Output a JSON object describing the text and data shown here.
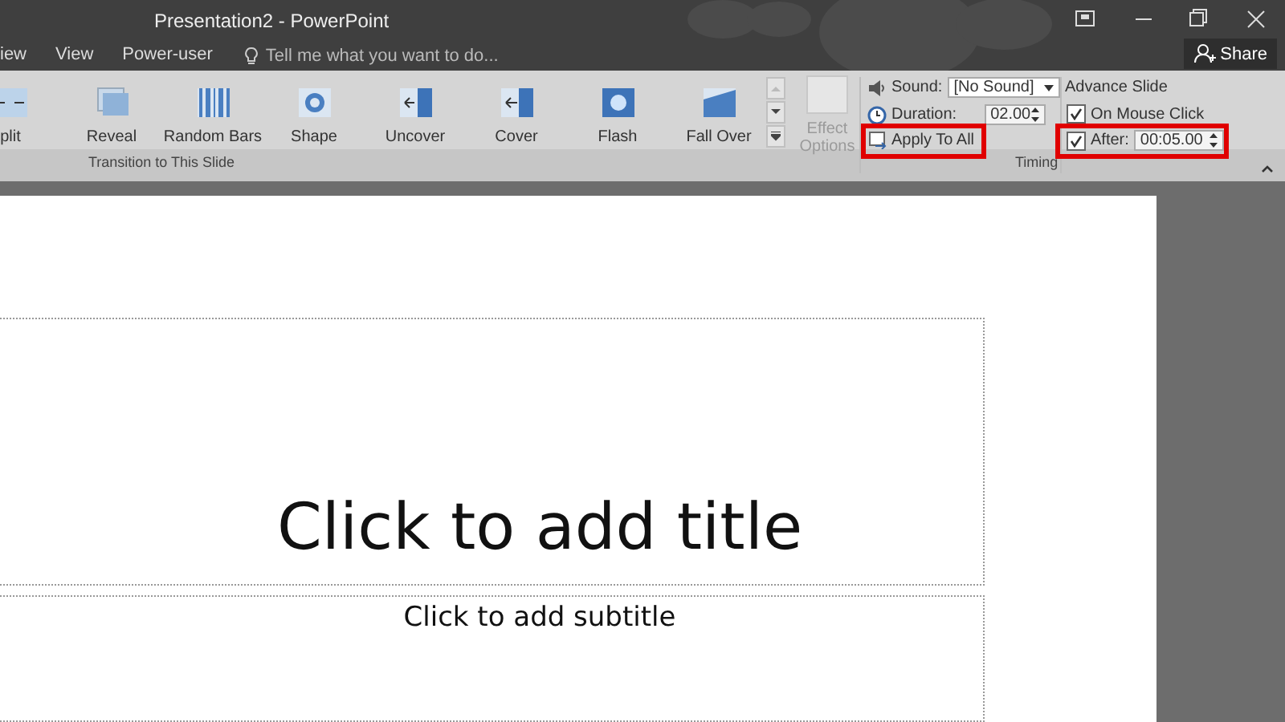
{
  "window": {
    "title": "Presentation2 - PowerPoint"
  },
  "tabs": [
    {
      "label": "iew"
    },
    {
      "label": "View"
    },
    {
      "label": "Power-user"
    }
  ],
  "tell_me": {
    "placeholder": "Tell me what you want to do..."
  },
  "share": {
    "label": "Share"
  },
  "transitions": {
    "items": [
      {
        "label": "plit"
      },
      {
        "label": "Reveal"
      },
      {
        "label": "Random Bars"
      },
      {
        "label": "Shape"
      },
      {
        "label": "Uncover"
      },
      {
        "label": "Cover"
      },
      {
        "label": "Flash"
      },
      {
        "label": "Fall Over"
      }
    ],
    "effect_options": {
      "label": "Effect Options",
      "disabled": true
    },
    "group_label": "Transition to This Slide"
  },
  "timing": {
    "sound": {
      "label": "Sound:",
      "value": "[No Sound]"
    },
    "duration": {
      "label": "Duration:",
      "value": "02.00"
    },
    "apply_to_all": {
      "label": "Apply To All"
    },
    "advance_slide": {
      "label": "Advance Slide",
      "on_mouse_click": {
        "label": "On Mouse Click",
        "checked": true
      },
      "after": {
        "label": "After:",
        "checked": true,
        "value": "00:05.00"
      }
    },
    "group_label": "Timing"
  },
  "slide": {
    "title_placeholder": "Click to add title",
    "subtitle_placeholder": "Click to add subtitle"
  }
}
